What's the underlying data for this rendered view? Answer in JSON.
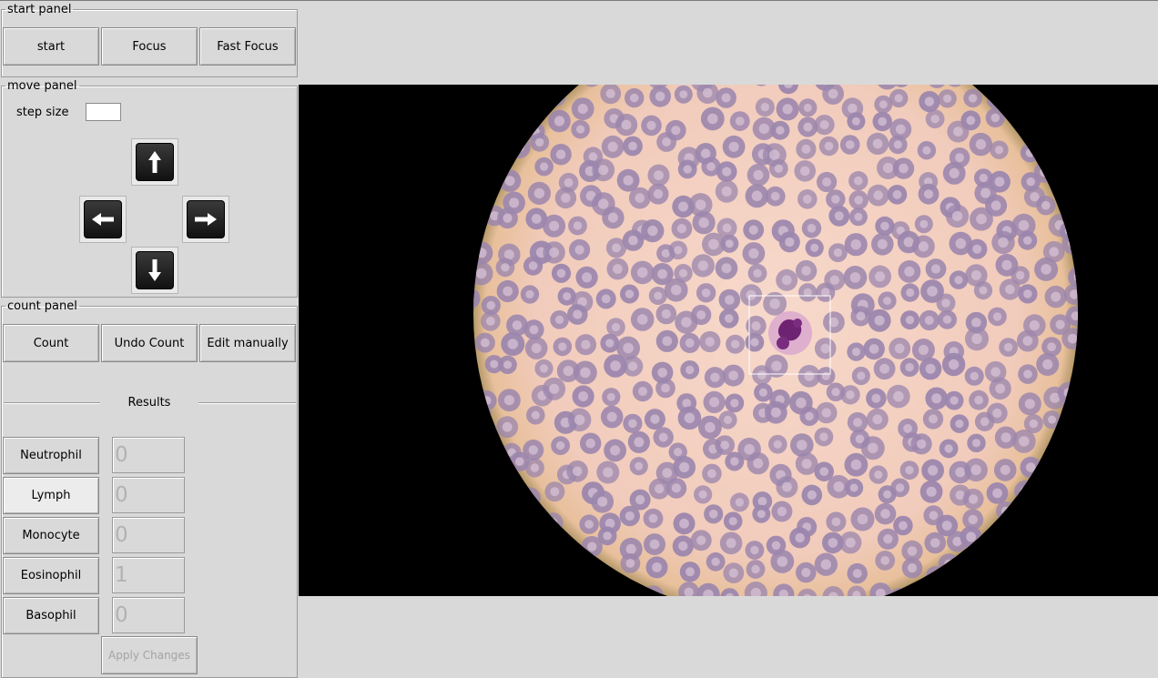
{
  "start_panel": {
    "legend": "start panel",
    "start_label": "start",
    "focus_label": "Focus",
    "fast_focus_label": "Fast Focus"
  },
  "move_panel": {
    "legend": "move panel",
    "step_size_label": "step size",
    "step_size_value": "",
    "arrows": [
      "arrow-up-icon",
      "arrow-left-icon",
      "arrow-right-icon",
      "arrow-down-icon"
    ]
  },
  "count_panel": {
    "legend": "count panel",
    "count_label": "Count",
    "undo_label": "Undo Count",
    "edit_label": "Edit manually",
    "results_heading": "Results",
    "results": [
      {
        "label": "Neutrophil",
        "value": "0"
      },
      {
        "label": "Lymph",
        "value": "0"
      },
      {
        "label": "Monocyte",
        "value": "0"
      },
      {
        "label": "Eosinophil",
        "value": "1"
      },
      {
        "label": "Basophil",
        "value": "0"
      }
    ],
    "apply_label": "Apply Changes"
  },
  "microscope_view": {
    "image": "blood-smear-microscope-field",
    "background_color": "#000000",
    "plasma_color": "#f3cfc0",
    "rbc_color": "#9b86ad",
    "wbc_color": "#7a2d7e",
    "selection_color": "#ffffff"
  }
}
